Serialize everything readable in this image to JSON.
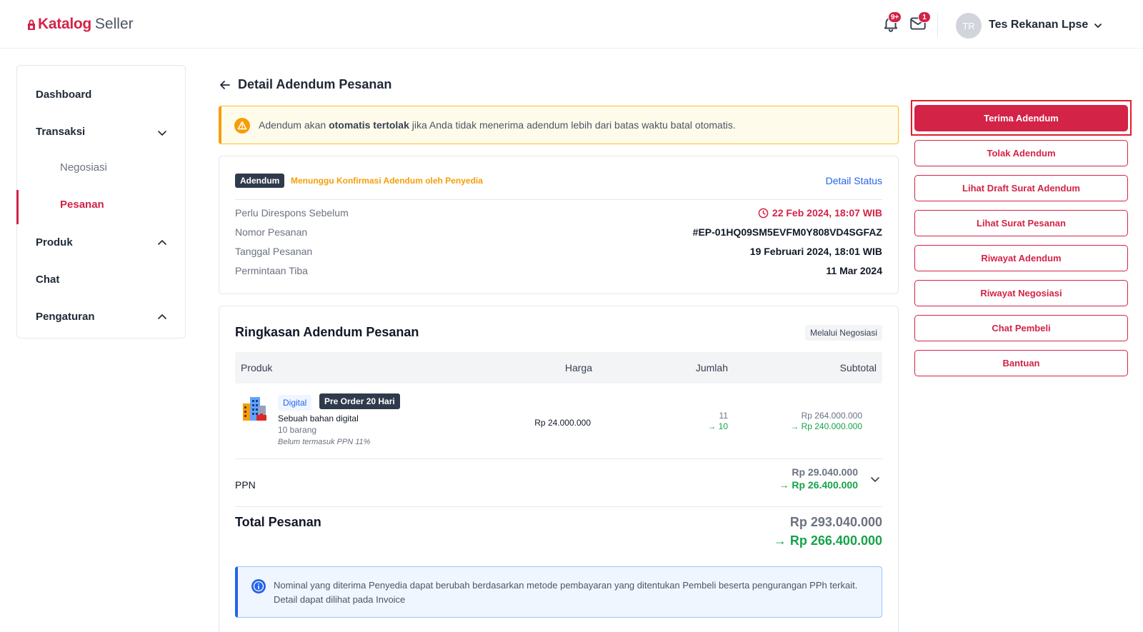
{
  "header": {
    "brand": "Katalog",
    "brand_suffix": "Seller",
    "notification_badge": "9+",
    "mail_badge": "1",
    "user_initials": "TR",
    "user_name": "Tes Rekanan Lpse"
  },
  "sidebar": {
    "items": [
      {
        "label": "Dashboard"
      },
      {
        "label": "Transaksi",
        "expanded": true,
        "children": [
          {
            "label": "Negosiasi"
          },
          {
            "label": "Pesanan",
            "active": true
          }
        ]
      },
      {
        "label": "Produk"
      },
      {
        "label": "Chat"
      },
      {
        "label": "Pengaturan"
      }
    ]
  },
  "page": {
    "title": "Detail Adendum Pesanan"
  },
  "warning": {
    "prefix": "Adendum akan ",
    "bold": "otomatis tertolak",
    "suffix": " jika Anda tidak menerima adendum lebih dari batas waktu batal otomatis."
  },
  "status_card": {
    "tag": "Adendum",
    "status": "Menunggu Konfirmasi Adendum oleh Penyedia",
    "detail_link": "Detail Status",
    "rows": [
      {
        "label": "Perlu Direspons Sebelum",
        "value": "22 Feb 2024, 18:07 WIB"
      },
      {
        "label": "Nomor Pesanan",
        "value": "#EP-01HQ09SM5EVFM0Y808VD4SGFAZ"
      },
      {
        "label": "Tanggal Pesanan",
        "value": "19 Februari 2024, 18:01 WIB"
      },
      {
        "label": "Permintaan Tiba",
        "value": "11 Mar 2024"
      }
    ]
  },
  "summary": {
    "title": "Ringkasan Adendum Pesanan",
    "source_tag": "Melalui Negosiasi",
    "columns": {
      "product": "Produk",
      "price": "Harga",
      "qty": "Jumlah",
      "subtotal": "Subtotal"
    },
    "item": {
      "type_tag": "Digital",
      "preorder_tag": "Pre Order 20 Hari",
      "name": "Sebuah bahan digital",
      "qty_text": "10 barang",
      "tax_note": "Belum termasuk PPN 11%",
      "price": "Rp 24.000.000",
      "qty_old": "11",
      "qty_new": "→ 10",
      "subtotal_old": "Rp 264.000.000",
      "subtotal_new": "→ Rp 240.000.000"
    },
    "ppn": {
      "label": "PPN",
      "old": "Rp 29.040.000",
      "new": "→ Rp 26.400.000"
    },
    "total": {
      "label": "Total Pesanan",
      "old": "Rp 293.040.000",
      "new": "→ Rp 266.400.000"
    },
    "info": "Nominal yang diterima Penyedia dapat berubah berdasarkan metode pembayaran yang ditentukan Pembeli beserta pengurangan PPh terkait. Detail dapat dilihat pada Invoice"
  },
  "actions": [
    {
      "label": "Terima Adendum"
    },
    {
      "label": "Tolak Adendum"
    },
    {
      "label": "Lihat Draft Surat Adendum"
    },
    {
      "label": "Lihat Surat Pesanan"
    },
    {
      "label": "Riwayat Adendum"
    },
    {
      "label": "Riwayat Negosiasi"
    },
    {
      "label": "Chat Pembeli"
    },
    {
      "label": "Bantuan"
    }
  ],
  "colors": {
    "brand": "#d32347",
    "success": "#16a34a",
    "warning": "#f59e0b",
    "info": "#2563eb"
  }
}
